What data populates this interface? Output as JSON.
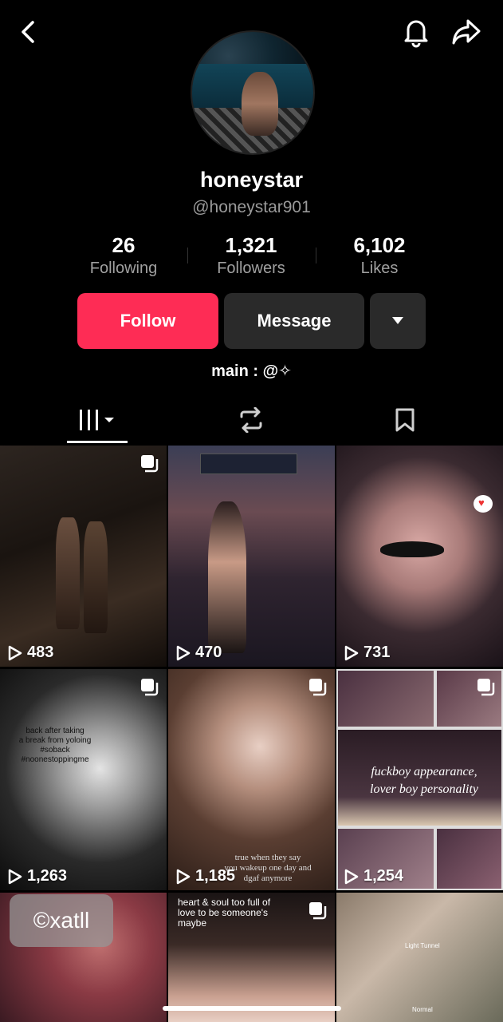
{
  "profile": {
    "display_name": "honeystar",
    "handle": "@honeystar901",
    "bio": "main : @✧"
  },
  "stats": [
    {
      "value": "26",
      "label": "Following"
    },
    {
      "value": "1,321",
      "label": "Followers"
    },
    {
      "value": "6,102",
      "label": "Likes"
    }
  ],
  "actions": {
    "follow_label": "Follow",
    "message_label": "Message"
  },
  "colors": {
    "follow": "#fe2c55",
    "button_dark": "#2a2a2a",
    "background": "#000000"
  },
  "tabs": [
    {
      "icon": "grid-icon",
      "active": true
    },
    {
      "icon": "repost-icon",
      "active": false
    },
    {
      "icon": "bookmark-icon",
      "active": false
    }
  ],
  "videos": [
    {
      "views": "483",
      "multi": true
    },
    {
      "views": "470",
      "multi": false
    },
    {
      "views": "731",
      "multi": false
    },
    {
      "views": "1,263",
      "multi": true,
      "caption": "back after taking\na break from yoloing\n#soback\n#noonestoppingme"
    },
    {
      "views": "1,185",
      "multi": true,
      "caption": "true when they say\nyou wakeup one day and\ndgaf anymore"
    },
    {
      "views": "1,254",
      "multi": true,
      "caption": "fuckboy appearance,\nlover boy personality"
    },
    {
      "views": "",
      "multi": false
    },
    {
      "views": "",
      "multi": true,
      "caption": "heart & soul too full of\nlove to be someone's\nmaybe"
    },
    {
      "views": "",
      "multi": false,
      "caption": "Light Tunnel",
      "caption2": "Normal"
    }
  ],
  "watermark": "©xatll"
}
